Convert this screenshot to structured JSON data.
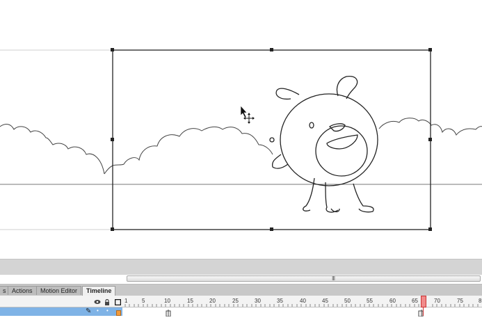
{
  "panels": {
    "tabs": [
      {
        "label": "s",
        "active": false
      },
      {
        "label": "Actions",
        "active": false
      },
      {
        "label": "Motion Editor",
        "active": false
      },
      {
        "label": "Timeline",
        "active": true
      }
    ]
  },
  "timeline": {
    "frame_numbers": [
      "1",
      "5",
      "10",
      "15",
      "20",
      "25",
      "30",
      "35",
      "40",
      "45",
      "50",
      "55",
      "60",
      "65",
      "70",
      "75",
      "8"
    ],
    "current_frame": 67,
    "layer_color": "#f29a3a"
  },
  "scrollbar": {
    "grip_label": "III"
  },
  "colors": {
    "selection": "#222222",
    "active_layer": "#7fb3e6",
    "playhead": "#f08a8a"
  }
}
